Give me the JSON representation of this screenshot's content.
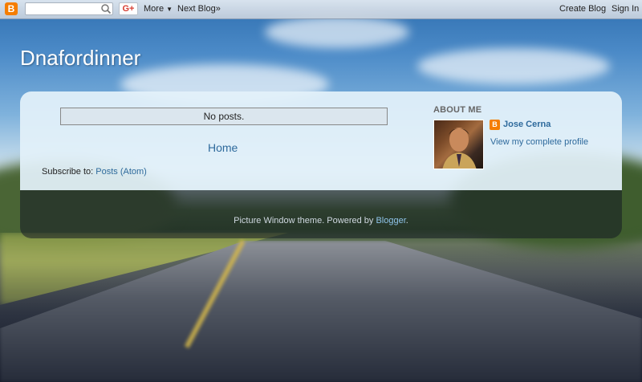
{
  "navbar": {
    "logo": "B",
    "search_value": "",
    "gplus": "G+",
    "more": "More",
    "next_blog": "Next Blog»",
    "create_blog": "Create Blog",
    "sign_in": "Sign In"
  },
  "header": {
    "title": "Dnafordinner"
  },
  "main": {
    "no_posts": "No posts.",
    "home_link": "Home",
    "subscribe_label": "Subscribe to: ",
    "subscribe_link": "Posts (Atom)"
  },
  "sidebar": {
    "about_heading": "ABOUT ME",
    "author_name": "Jose Cerna",
    "profile_link": "View my complete profile"
  },
  "footer": {
    "text": "Picture Window theme. Powered by ",
    "link": "Blogger",
    "end": "."
  },
  "colors": {
    "accent": "#f57d00",
    "link": "#2e6a9c"
  }
}
